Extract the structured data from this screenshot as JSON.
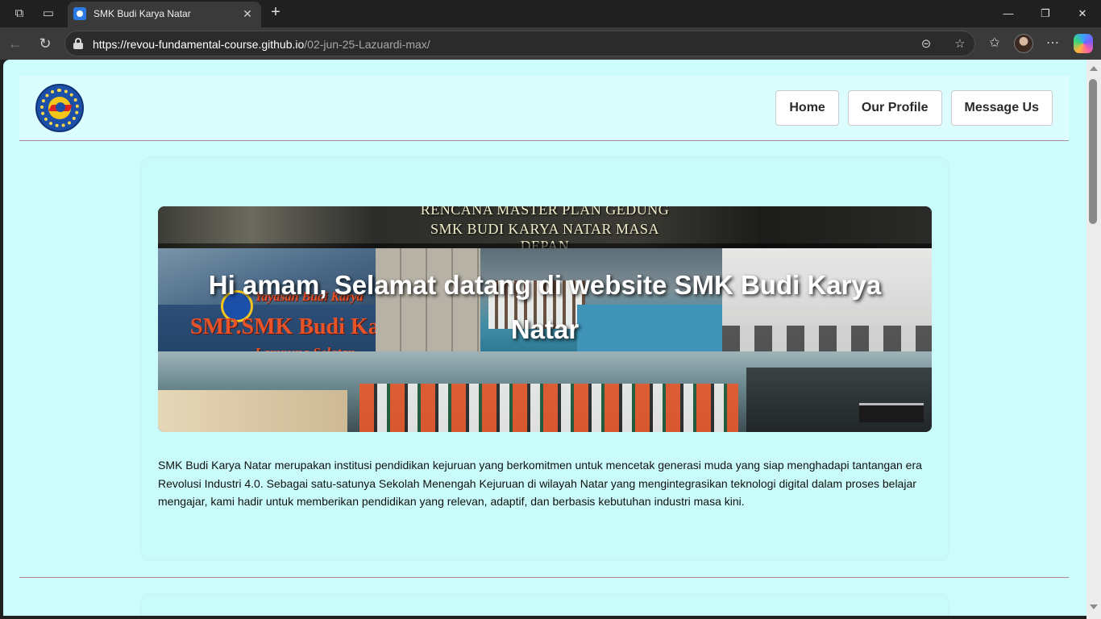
{
  "browser": {
    "tab_title": "SMK Budi Karya Natar",
    "url_host": "https://revou-fundamental-course.github.io",
    "url_path": "/02-jun-25-Lazuardi-max/",
    "icons": {
      "workspaces": "workspaces-icon",
      "tab_actions": "tab-actions-icon",
      "close_tab": "close-icon",
      "new_tab": "plus-icon",
      "minimize": "minimize-icon",
      "maximize": "restore-icon",
      "close_window": "close-icon",
      "back": "back-arrow-icon",
      "refresh": "refresh-icon",
      "site_info": "lock-icon",
      "reader": "reader-icon",
      "favorite": "star-icon",
      "favorites": "favorites-icon",
      "more": "more-icon",
      "copilot": "copilot-icon"
    },
    "glyphs": {
      "workspaces": "⧉",
      "tab_actions": "▭",
      "close_tab": "✕",
      "new_tab": "+",
      "minimize": "—",
      "maximize": "❐",
      "close_window": "✕",
      "back": "←",
      "refresh": "↻",
      "reader": "⊝",
      "favorite": "☆",
      "favorites": "✩",
      "more": "⋯"
    }
  },
  "site": {
    "logo_alt": "SMK Budi Karya Natar logo",
    "nav": [
      {
        "label": "Home"
      },
      {
        "label": "Our Profile"
      },
      {
        "label": "Message Us"
      }
    ],
    "hero": {
      "banner_line1": "RENCANA MASTER PLAN GEDUNG",
      "banner_line2": "SMK BUDI KARYA NATAR MASA DEPAN",
      "sign_line1": "Yayasan Budi Karya",
      "sign_line2": "SMP.SMK Budi Karya Natar",
      "sign_line3": "Lampung Selatan",
      "title": "Hi amam, Selamat datang di website SMK Budi Karya Natar"
    },
    "intro_text": "SMK Budi Karya Natar merupakan institusi pendidikan kejuruan yang berkomitmen untuk mencetak generasi muda yang siap menghadapi tantangan era Revolusi Industri 4.0. Sebagai satu-satunya Sekolah Menengah Kejuruan di wilayah Natar yang mengintegrasikan teknologi digital dalam proses belajar mengajar, kami hadir untuk memberikan pendidikan yang relevan, adaptif, dan berbasis kebutuhan industri masa kini."
  },
  "colors": {
    "page_bg": "#cdfcfc",
    "header_bg": "#dcfdfd",
    "divider": "#b08a90",
    "chrome_dark": "#202020",
    "chrome_bar": "#3a3a3a"
  }
}
